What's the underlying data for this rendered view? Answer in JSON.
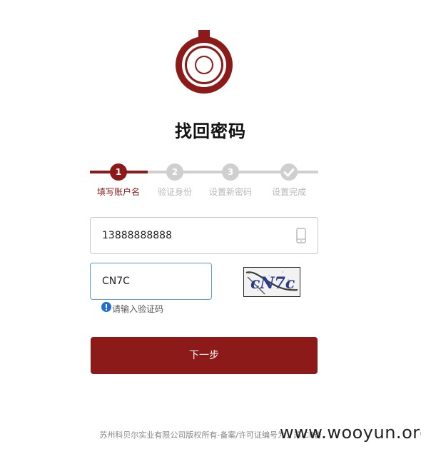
{
  "page": {
    "title": "找回密码"
  },
  "steps": [
    {
      "number": "1",
      "label": "填写账户名",
      "state": "active"
    },
    {
      "number": "2",
      "label": "验证身份",
      "state": "pending"
    },
    {
      "number": "3",
      "label": "设置新密码",
      "state": "pending"
    },
    {
      "number": "",
      "label": "设置完成",
      "state": "pending",
      "icon": "check-icon"
    }
  ],
  "form": {
    "phone_value": "13888888888",
    "phone_icon": "mobile-phone-icon",
    "captcha_value": "CN7C",
    "captcha_image_text": "cN7c",
    "hint_icon": "info-icon",
    "hint_text": "请输入验证码",
    "next_label": "下一步"
  },
  "footer": {
    "text": "苏州科贝尔实业有限公司版权所有-备案/许可证编号为：苏ICP备"
  },
  "watermark": {
    "text": "www.wooyun.org"
  },
  "colors": {
    "accent": "#8c1a18",
    "inactive": "#cfcfcf",
    "focus_border": "#5a9bd5"
  }
}
